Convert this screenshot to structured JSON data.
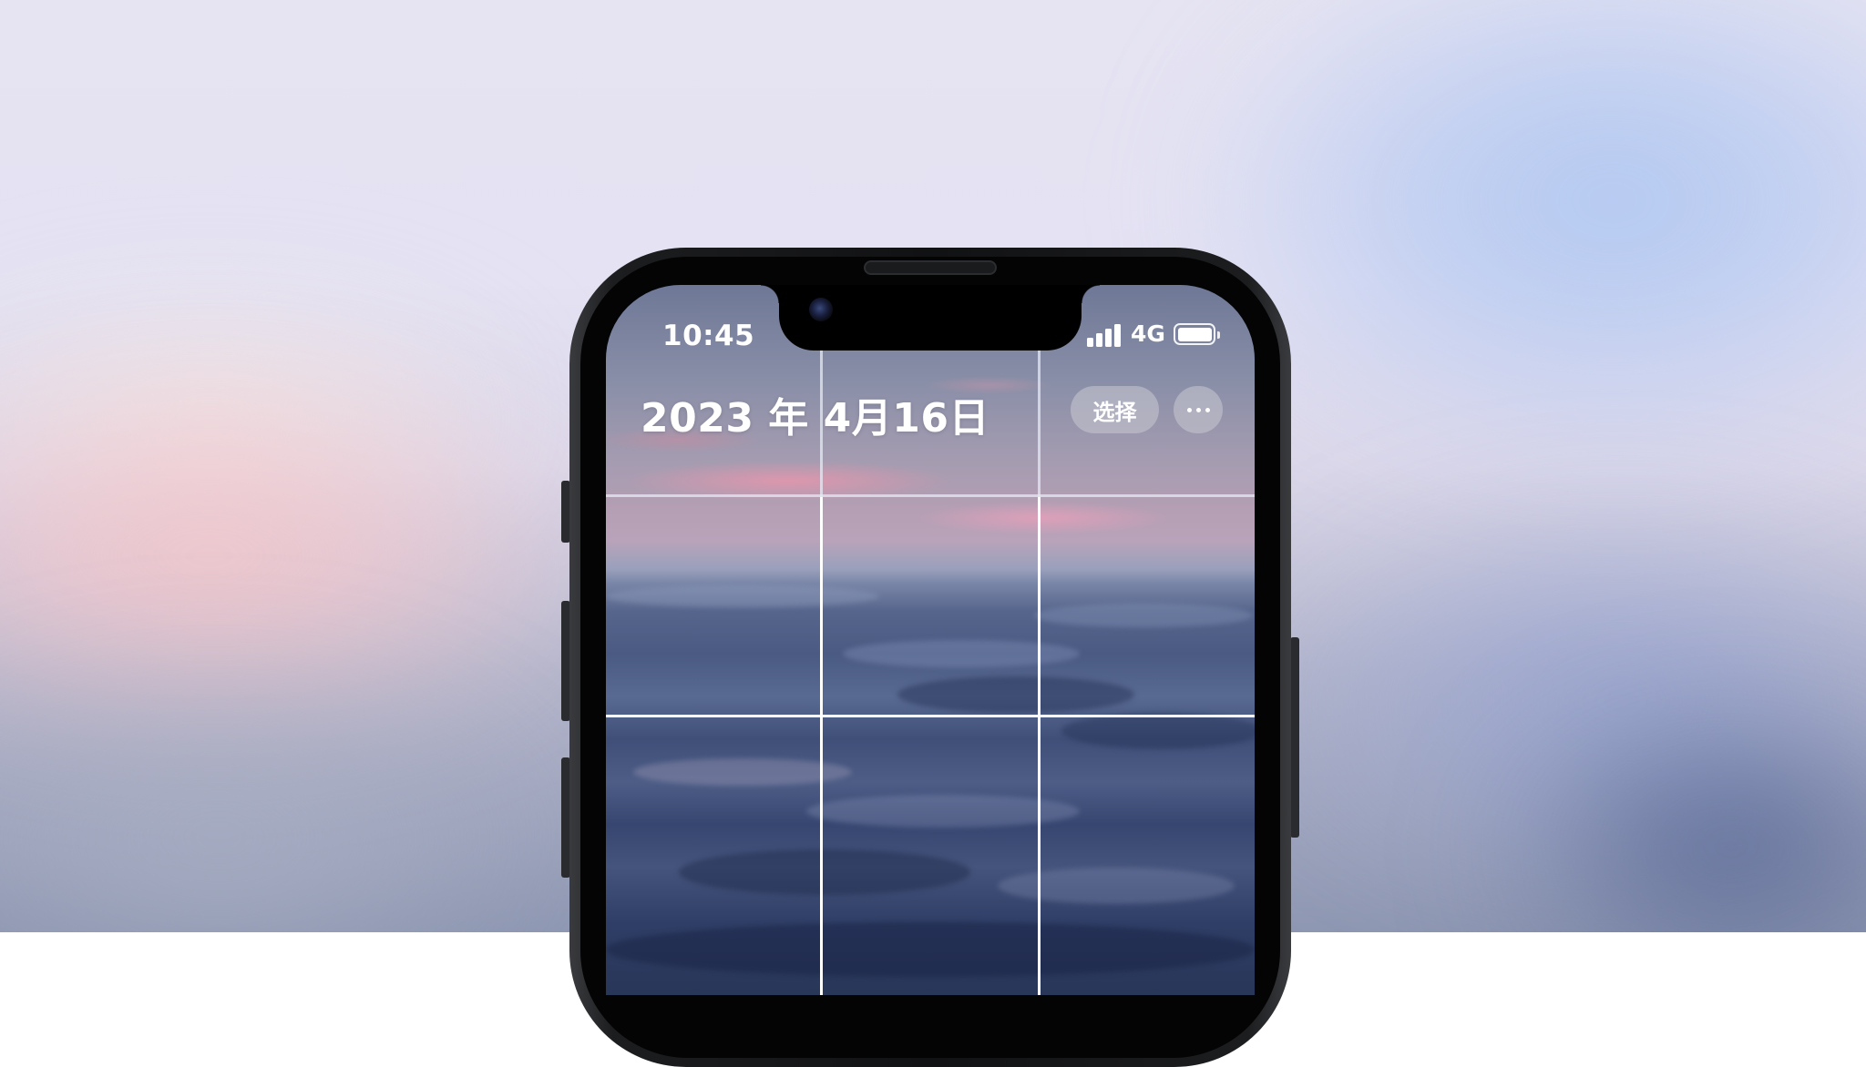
{
  "status_bar": {
    "time": "10:45",
    "network": "4G"
  },
  "header": {
    "title": "2023 年 4月16日",
    "select_label": "选择",
    "more_icon": "ellipsis-icon"
  },
  "photo_grid": {
    "columns": 3,
    "visible_rows": 3
  },
  "icons": [
    "signal-icon",
    "battery-icon",
    "ellipsis-icon"
  ]
}
